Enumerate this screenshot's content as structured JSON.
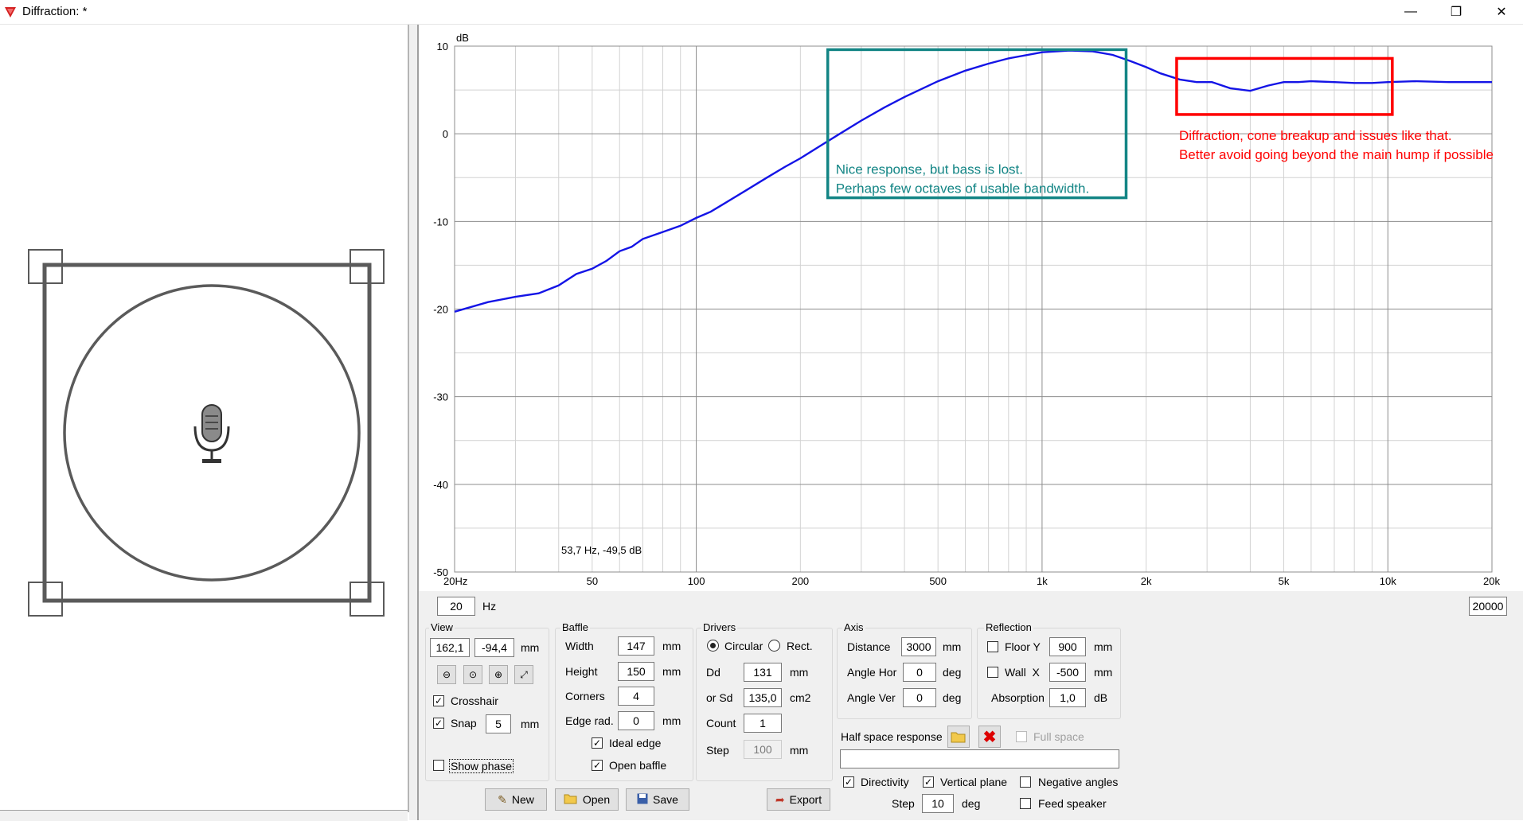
{
  "window": {
    "title": "Diffraction: *",
    "minimize": "—",
    "restore": "❐",
    "close": "✕"
  },
  "chart_data": {
    "type": "line",
    "y_unit": "dB",
    "x_scale": "log",
    "xlim": [
      20,
      20000
    ],
    "ylim": [
      -50,
      10
    ],
    "x_ticks": [
      20,
      50,
      100,
      200,
      500,
      1000,
      2000,
      5000,
      10000,
      20000
    ],
    "x_tick_labels": [
      "20Hz",
      "50",
      "100",
      "200",
      "500",
      "1k",
      "2k",
      "5k",
      "10k",
      "20k"
    ],
    "y_ticks": [
      10,
      0,
      -10,
      -20,
      -30,
      -40,
      -50
    ],
    "y_tick_labels": [
      "10",
      "0",
      "-10",
      "-20",
      "-30",
      "-40",
      "-50"
    ],
    "grid": true,
    "series": [
      {
        "color": "#1414e6",
        "x": [
          20,
          25,
          30,
          35,
          40,
          45,
          50,
          55,
          60,
          65,
          70,
          80,
          90,
          100,
          110,
          120,
          140,
          160,
          180,
          200,
          230,
          260,
          300,
          350,
          400,
          500,
          600,
          700,
          800,
          1000,
          1200,
          1400,
          1600,
          1800,
          2000,
          2200,
          2500,
          2800,
          3100,
          3500,
          4000,
          4500,
          5000,
          5500,
          6000,
          7000,
          8000,
          9000,
          10000,
          12000,
          15000,
          20000
        ],
        "y": [
          -20.3,
          -19.2,
          -18.6,
          -18.2,
          -17.3,
          -16.0,
          -15.4,
          -14.5,
          -13.4,
          -12.9,
          -12.0,
          -11.2,
          -10.5,
          -9.6,
          -8.9,
          -8.0,
          -6.4,
          -5.0,
          -3.8,
          -2.8,
          -1.3,
          0.0,
          1.5,
          3.0,
          4.2,
          6.0,
          7.2,
          8.0,
          8.6,
          9.3,
          9.5,
          9.4,
          9.0,
          8.3,
          7.6,
          6.9,
          6.2,
          5.9,
          5.9,
          5.2,
          4.9,
          5.5,
          5.9,
          5.9,
          6.0,
          5.9,
          5.8,
          5.8,
          5.9,
          6.0,
          5.9,
          5.9
        ]
      }
    ],
    "annotations": [
      {
        "type": "box",
        "color": "#138585",
        "x_range": [
          240,
          1750
        ],
        "y_range": [
          -7.3,
          9.6
        ],
        "text": [
          "Nice response, but bass is lost.",
          "Perhaps few octaves of usable bandwidth."
        ]
      },
      {
        "type": "box",
        "color": "#ff0000",
        "x_range": [
          2450,
          10300
        ],
        "y_range": [
          2.2,
          8.6
        ],
        "text": [
          "Diffraction, cone breakup and issues like that.",
          "Better avoid going beyond the main hump if possible"
        ]
      }
    ],
    "cursor_readout": "53,7 Hz, -49,5 dB"
  },
  "freq": {
    "min": "20",
    "max": "20000",
    "unit": "Hz"
  },
  "view": {
    "title": "View",
    "x": "162,1",
    "y": "-94,4",
    "unit": "mm",
    "crosshair_label": "Crosshair",
    "crosshair_checked": "✓",
    "snap_label": "Snap",
    "snap_checked": "✓",
    "snap_value": "5",
    "snap_unit": "mm",
    "show_phase_label": "Show phase",
    "show_phase_checked": ""
  },
  "baffle": {
    "title": "Baffle",
    "width_label": "Width",
    "width": "147",
    "width_unit": "mm",
    "height_label": "Height",
    "height": "150",
    "height_unit": "mm",
    "corners_label": "Corners",
    "corners": "4",
    "edge_label": "Edge rad.",
    "edge": "0",
    "edge_unit": "mm",
    "ideal_edge_label": "Ideal edge",
    "ideal_edge_checked": "✓",
    "open_baffle_label": "Open baffle",
    "open_baffle_checked": "✓"
  },
  "drivers": {
    "title": "Drivers",
    "circular_label": "Circular",
    "rect_label": "Rect.",
    "dd_label": "Dd",
    "dd": "131",
    "dd_unit": "mm",
    "sd_label": "or Sd",
    "sd": "135,0",
    "sd_unit": "cm2",
    "count_label": "Count",
    "count": "1",
    "step_label": "Step",
    "step": "100",
    "step_unit": "mm"
  },
  "axis": {
    "title": "Axis",
    "distance_label": "Distance",
    "distance": "3000",
    "distance_unit": "mm",
    "angle_hor_label": "Angle Hor",
    "angle_hor": "0",
    "angle_hor_unit": "deg",
    "angle_ver_label": "Angle Ver",
    "angle_ver": "0",
    "angle_ver_unit": "deg"
  },
  "reflection": {
    "title": "Reflection",
    "floor_label": "Floor Y",
    "floor": "900",
    "floor_unit": "mm",
    "wall_label": "Wall  X",
    "wall": "-500",
    "wall_unit": "mm",
    "absorption_label": "Absorption",
    "absorption": "1,0",
    "absorption_unit": "dB"
  },
  "half_space": {
    "label": "Half space response",
    "full_space_label": "Full space",
    "path": ""
  },
  "options": {
    "directivity_label": "Directivity",
    "directivity_checked": "✓",
    "vertical_plane_label": "Vertical plane",
    "vertical_plane_checked": "✓",
    "negative_angles_label": "Negative angles",
    "negative_angles_checked": "",
    "feed_speaker_label": "Feed speaker",
    "feed_speaker_checked": "",
    "step_label": "Step",
    "step": "10",
    "step_unit": "deg"
  },
  "buttons": {
    "new": "New",
    "open": "Open",
    "save": "Save",
    "export": "Export"
  },
  "colors": {
    "accent": "#1414e6",
    "teal": "#138585",
    "red": "#ff0000",
    "grid_major": "#8c8c8c",
    "grid_minor": "#d2d2d2"
  }
}
